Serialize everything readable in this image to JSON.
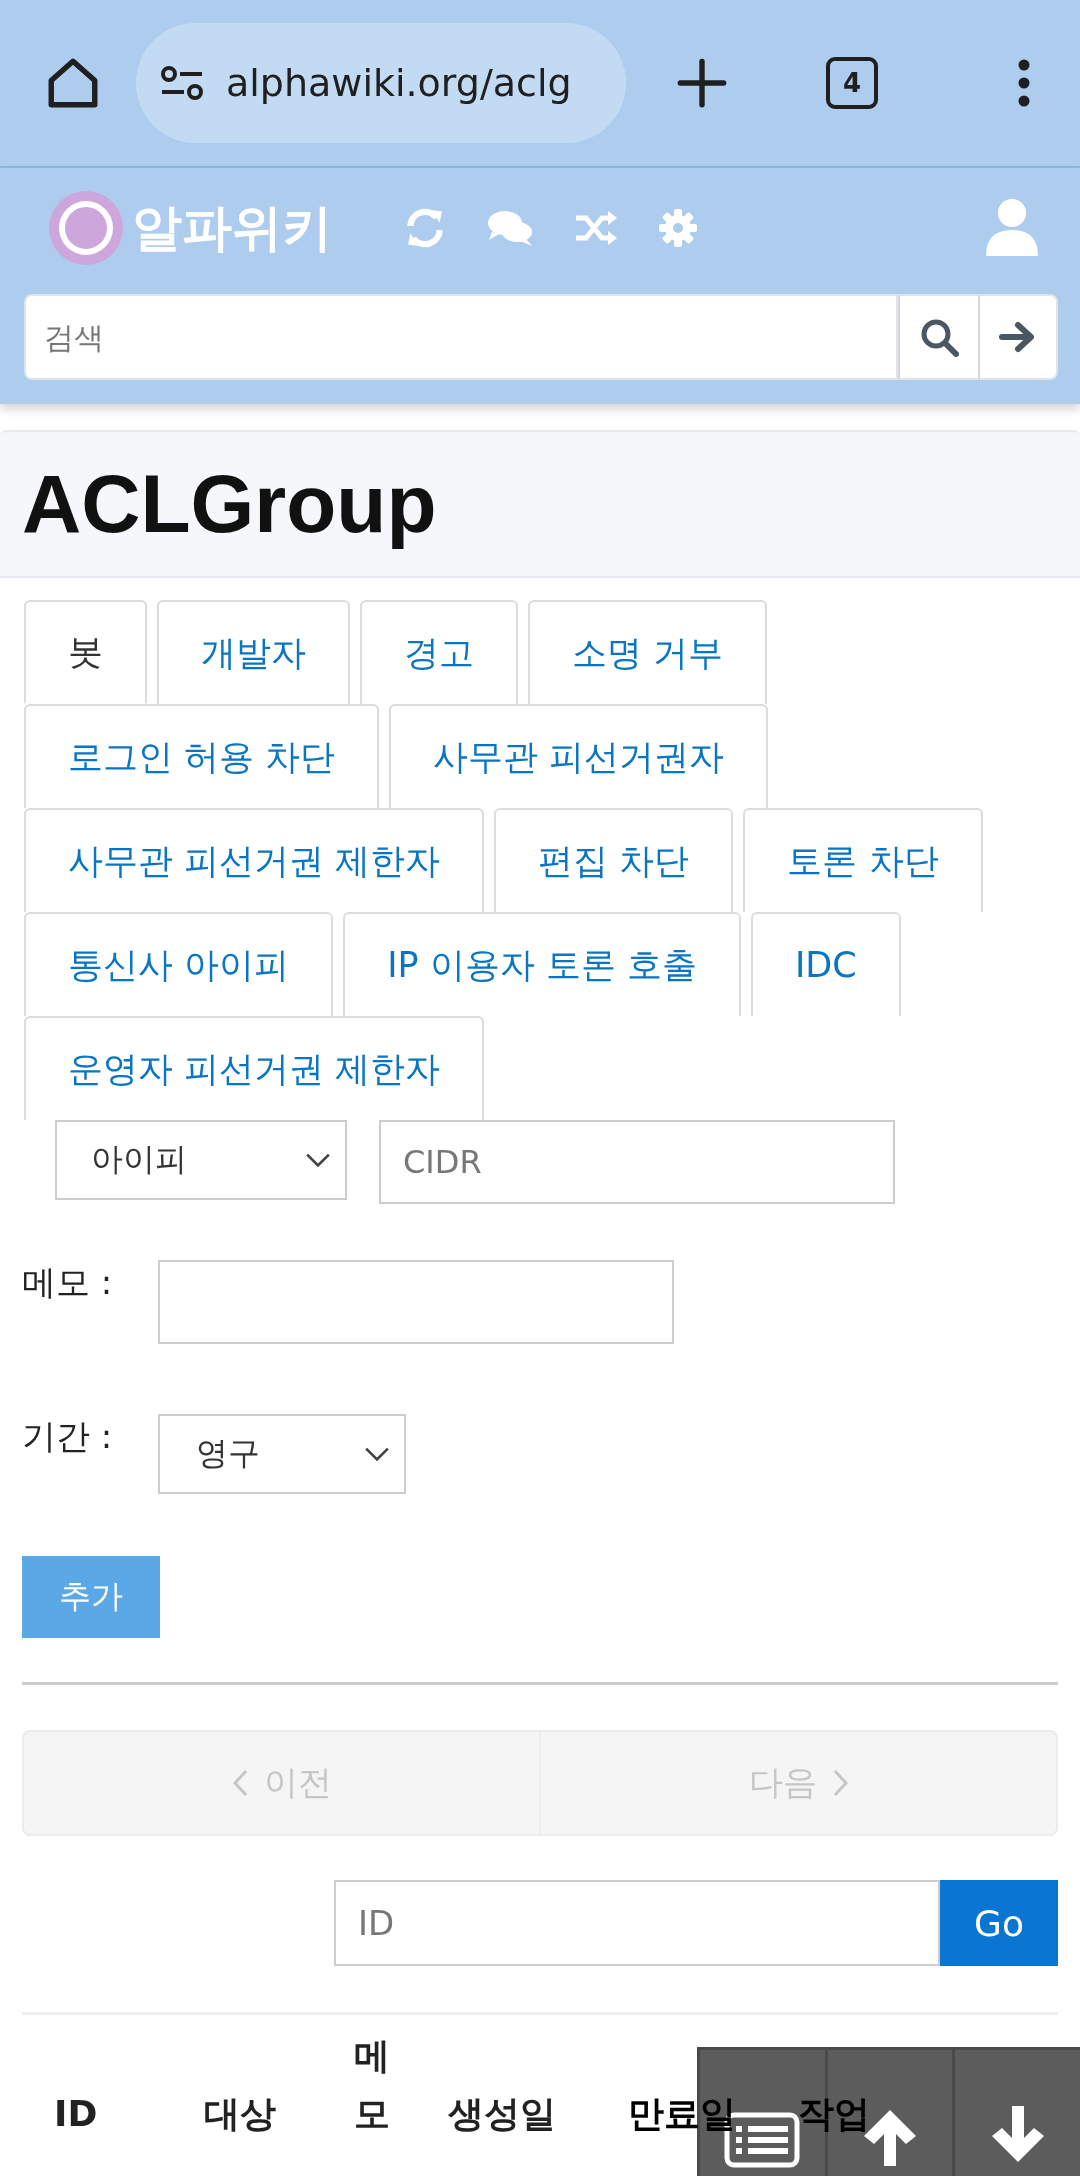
{
  "browser": {
    "url": "alphawiki.org/aclg",
    "tab_count": "4"
  },
  "site": {
    "name": "알파위키",
    "search_placeholder": "검색"
  },
  "title": "ACLGroup",
  "tabs": [
    {
      "label": "봇",
      "selected": true
    },
    {
      "label": "개발자",
      "selected": false
    },
    {
      "label": "경고",
      "selected": false
    },
    {
      "label": "소명 거부",
      "selected": false
    },
    {
      "label": "로그인 허용 차단",
      "selected": false
    },
    {
      "label": "사무관 피선거권자",
      "selected": false
    },
    {
      "label": "사무관 피선거권 제한자",
      "selected": false
    },
    {
      "label": "편집 차단",
      "selected": false
    },
    {
      "label": "토론 차단",
      "selected": false
    },
    {
      "label": "통신사 아이피",
      "selected": false
    },
    {
      "label": "IP 이용자 토론 호출",
      "selected": false
    },
    {
      "label": "IDC",
      "selected": false
    },
    {
      "label": "운영자 피선거권 제한자",
      "selected": false
    }
  ],
  "form": {
    "type_select": "아이피",
    "cidr_placeholder": "CIDR",
    "memo_label": "메모 :",
    "period_label": "기간 :",
    "period_select": "영구",
    "add_button": "추가"
  },
  "pagination": {
    "prev": {
      "label": "이전",
      "disabled": true
    },
    "next": {
      "label": "다음",
      "disabled": true
    }
  },
  "id_search": {
    "placeholder": "ID",
    "button": "Go"
  },
  "table": {
    "columns": [
      "ID",
      "대상",
      "메모",
      "생성일",
      "만료일",
      "작업"
    ]
  }
}
